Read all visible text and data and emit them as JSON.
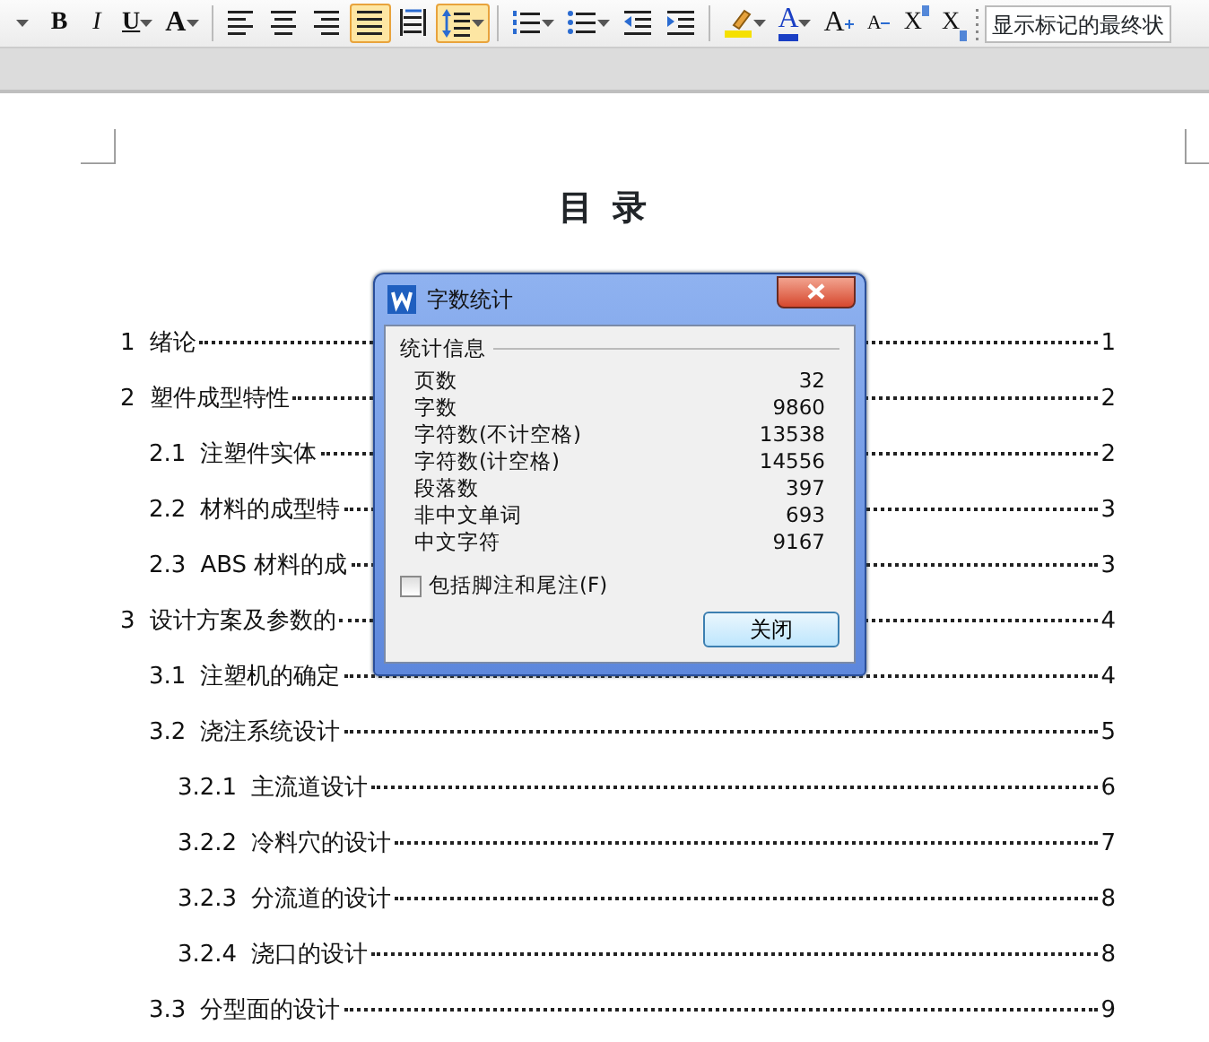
{
  "toolbar": {
    "buttons": [
      {
        "kind": "caret",
        "selected": false
      },
      {
        "kind": "bold",
        "label": "B",
        "selected": false
      },
      {
        "kind": "italic",
        "label": "I",
        "selected": false
      },
      {
        "kind": "underline",
        "label": "U",
        "selected": false,
        "dropdown": true
      },
      {
        "kind": "fontgrow_fx",
        "label": "A",
        "selected": false,
        "dropdown": true
      },
      {
        "kind": "sep"
      },
      {
        "kind": "align_left",
        "selected": false
      },
      {
        "kind": "align_center",
        "selected": false
      },
      {
        "kind": "align_right",
        "selected": false
      },
      {
        "kind": "justify",
        "selected": true
      },
      {
        "kind": "distribute",
        "selected": false
      },
      {
        "kind": "line_spacing",
        "selected": true,
        "dropdown": true
      },
      {
        "kind": "sep"
      },
      {
        "kind": "numbered_list",
        "selected": false,
        "dropdown": true
      },
      {
        "kind": "bullet_list",
        "selected": false,
        "dropdown": true
      },
      {
        "kind": "outdent",
        "selected": false
      },
      {
        "kind": "indent",
        "selected": false
      },
      {
        "kind": "sep"
      },
      {
        "kind": "highlight",
        "selected": false,
        "dropdown": true
      },
      {
        "kind": "font_color",
        "label": "A",
        "selected": false,
        "dropdown": true
      },
      {
        "kind": "grow",
        "label": "A",
        "selected": false
      },
      {
        "kind": "shrink",
        "label": "A",
        "selected": false
      },
      {
        "kind": "superscript",
        "label": "X",
        "selected": false
      },
      {
        "kind": "subscript",
        "label": "X",
        "selected": false
      },
      {
        "kind": "grip"
      }
    ],
    "markup_mode": "显示标记的最终状"
  },
  "document": {
    "title": "目 录",
    "toc": [
      {
        "number": "1",
        "title": "绪论",
        "page": "1"
      },
      {
        "number": "2",
        "title": "塑件成型特性",
        "page": "2",
        "children": [
          {
            "number": "2.1",
            "title": "注塑件实体",
            "page": "2"
          },
          {
            "number": "2.2",
            "title": "材料的成型特",
            "page": "3"
          },
          {
            "number": "2.3",
            "title": "ABS 材料的成",
            "page": "3"
          }
        ]
      },
      {
        "number": "3",
        "title": "设计方案及参数的",
        "page": "4",
        "children": [
          {
            "number": "3.1",
            "title": "注塑机的确定",
            "page": "4"
          },
          {
            "number": "3.2",
            "title": "浇注系统设计",
            "page": "5",
            "children": [
              {
                "number": "3.2.1",
                "title": "主流道设计",
                "page": "6"
              },
              {
                "number": "3.2.2",
                "title": "冷料穴的设计",
                "page": "7"
              },
              {
                "number": "3.2.3",
                "title": "分流道的设计",
                "page": "8"
              },
              {
                "number": "3.2.4",
                "title": "浇口的设计",
                "page": "8"
              }
            ]
          },
          {
            "number": "3.3",
            "title": "分型面的设计",
            "page": "9"
          }
        ]
      }
    ]
  },
  "dialog": {
    "title": "字数统计",
    "group": "统计信息",
    "stats": [
      {
        "label": "页数",
        "value": "32"
      },
      {
        "label": "字数",
        "value": "9860"
      },
      {
        "label": "字符数(不计空格)",
        "value": "13538"
      },
      {
        "label": "字符数(计空格)",
        "value": "14556"
      },
      {
        "label": "段落数",
        "value": "397"
      },
      {
        "label": "非中文单词",
        "value": "693"
      },
      {
        "label": "中文字符",
        "value": "9167"
      }
    ],
    "checkbox": {
      "label": "包括脚注和尾注(F)",
      "checked": false
    },
    "close_button": "关闭"
  }
}
